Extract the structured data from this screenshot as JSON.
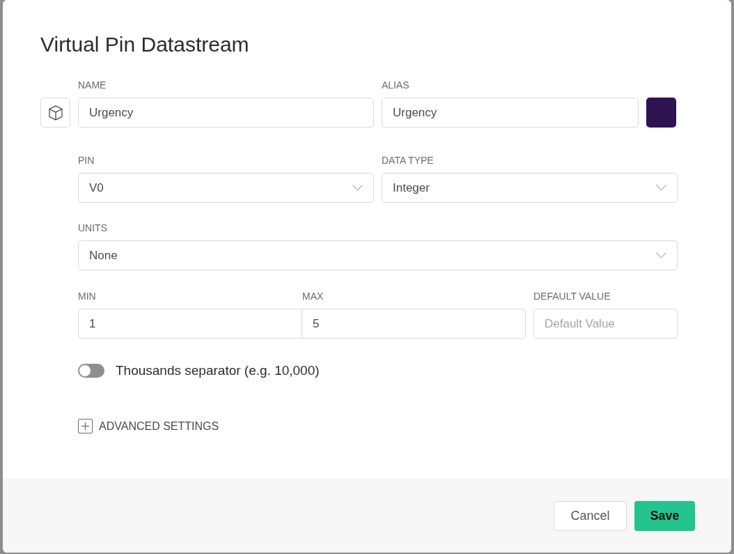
{
  "dialog": {
    "title": "Virtual Pin Datastream"
  },
  "name_field": {
    "label": "NAME",
    "value": "Urgency"
  },
  "alias_field": {
    "label": "ALIAS",
    "value": "Urgency"
  },
  "color_swatch": {
    "color": "#2e1452"
  },
  "pin_field": {
    "label": "PIN",
    "value": "V0"
  },
  "data_type_field": {
    "label": "DATA TYPE",
    "value": "Integer"
  },
  "units_field": {
    "label": "UNITS",
    "value": "None"
  },
  "min_field": {
    "label": "MIN",
    "value": "1"
  },
  "max_field": {
    "label": "MAX",
    "value": "5"
  },
  "default_value_field": {
    "label": "DEFAULT VALUE",
    "placeholder": "Default Value"
  },
  "thousands_separator": {
    "label": "Thousands separator (e.g. 10,000)",
    "on": false
  },
  "advanced_settings": {
    "label": "ADVANCED SETTINGS",
    "expanded": false
  },
  "buttons": [
    {
      "label": "Cancel",
      "kind": "secondary"
    },
    {
      "label": "Save",
      "kind": "primary"
    }
  ]
}
